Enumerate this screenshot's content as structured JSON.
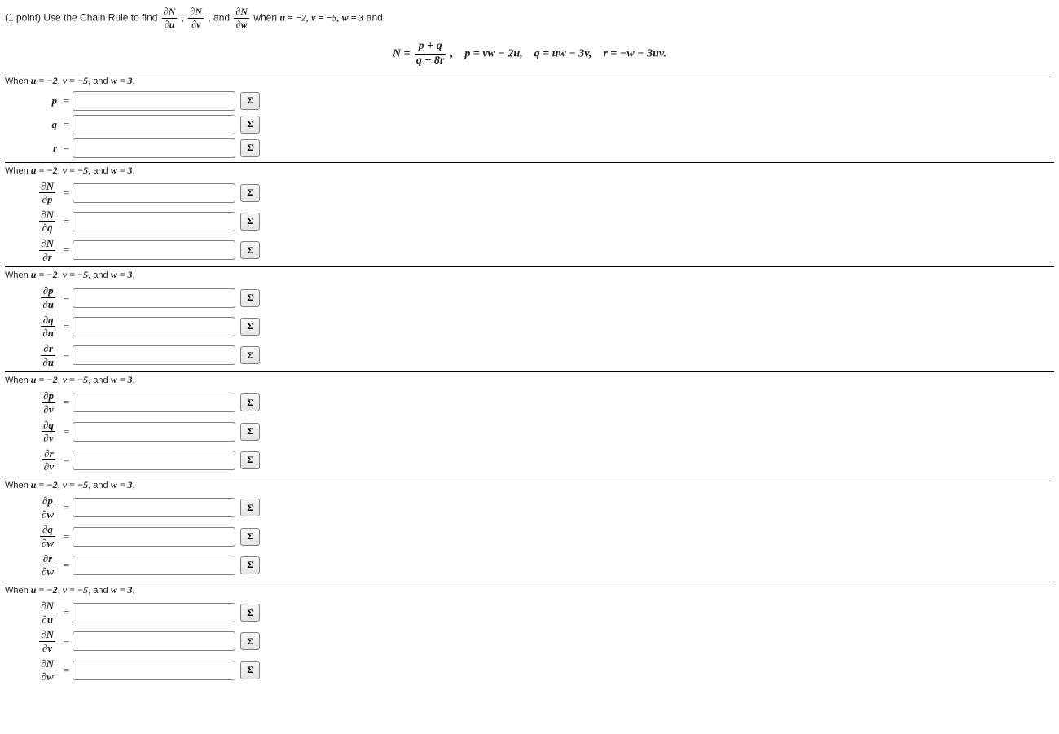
{
  "problem": {
    "points_prefix": "(1 point) Use the Chain Rule to find ",
    "d1_num": "∂N",
    "d1_den": "∂u",
    "d2_num": "∂N",
    "d2_den": "∂v",
    "d3_num": "∂N",
    "d3_den": "∂w",
    "comma": ", ",
    "and": ", and ",
    "when_text": " when ",
    "conds": "u = −2, v = −5, w = 3",
    "and_tail": " and:",
    "values": {
      "u": -2,
      "v": -5,
      "w": 3
    }
  },
  "equation": {
    "N_eq": "N = ",
    "Nfrac_num": "p + q",
    "Nfrac_den": "q + 8r",
    "tail": ",    p = vw − 2u,    q = uw − 3v,    r = −w − 3uv."
  },
  "section_header": "When u = −2, v = −5, and w = 3,",
  "sigma": "Σ",
  "sections": [
    {
      "rows": [
        {
          "label_html": "<span class='ital bold'>p</span>"
        },
        {
          "label_html": "<span class='ital bold'>q</span>"
        },
        {
          "label_html": "<span class='ital bold'>r</span>"
        }
      ]
    },
    {
      "rows": [
        {
          "label_html": "<span class='frac'><span class='num bold ital'>∂N</span><span class='den bold ital'>∂p</span></span>"
        },
        {
          "label_html": "<span class='frac'><span class='num bold ital'>∂N</span><span class='den bold ital'>∂q</span></span>"
        },
        {
          "label_html": "<span class='frac'><span class='num bold ital'>∂N</span><span class='den bold ital'>∂r</span></span>"
        }
      ]
    },
    {
      "rows": [
        {
          "label_html": "<span class='frac'><span class='num bold ital'>∂p</span><span class='den bold ital'>∂u</span></span>"
        },
        {
          "label_html": "<span class='frac'><span class='num bold ital'>∂q</span><span class='den bold ital'>∂u</span></span>"
        },
        {
          "label_html": "<span class='frac'><span class='num bold ital'>∂r</span><span class='den bold ital'>∂u</span></span>"
        }
      ]
    },
    {
      "rows": [
        {
          "label_html": "<span class='frac'><span class='num bold ital'>∂p</span><span class='den bold ital'>∂v</span></span>"
        },
        {
          "label_html": "<span class='frac'><span class='num bold ital'>∂q</span><span class='den bold ital'>∂v</span></span>"
        },
        {
          "label_html": "<span class='frac'><span class='num bold ital'>∂r</span><span class='den bold ital'>∂v</span></span>"
        }
      ]
    },
    {
      "rows": [
        {
          "label_html": "<span class='frac'><span class='num bold ital'>∂p</span><span class='den bold ital'>∂w</span></span>"
        },
        {
          "label_html": "<span class='frac'><span class='num bold ital'>∂q</span><span class='den bold ital'>∂w</span></span>"
        },
        {
          "label_html": "<span class='frac'><span class='num bold ital'>∂r</span><span class='den bold ital'>∂w</span></span>"
        }
      ]
    },
    {
      "rows": [
        {
          "label_html": "<span class='frac'><span class='num bold ital'>∂N</span><span class='den bold ital'>∂u</span></span>"
        },
        {
          "label_html": "<span class='frac'><span class='num bold ital'>∂N</span><span class='den bold ital'>∂v</span></span>"
        },
        {
          "label_html": "<span class='frac'><span class='num bold ital'>∂N</span><span class='den bold ital'>∂w</span></span>"
        }
      ]
    }
  ]
}
